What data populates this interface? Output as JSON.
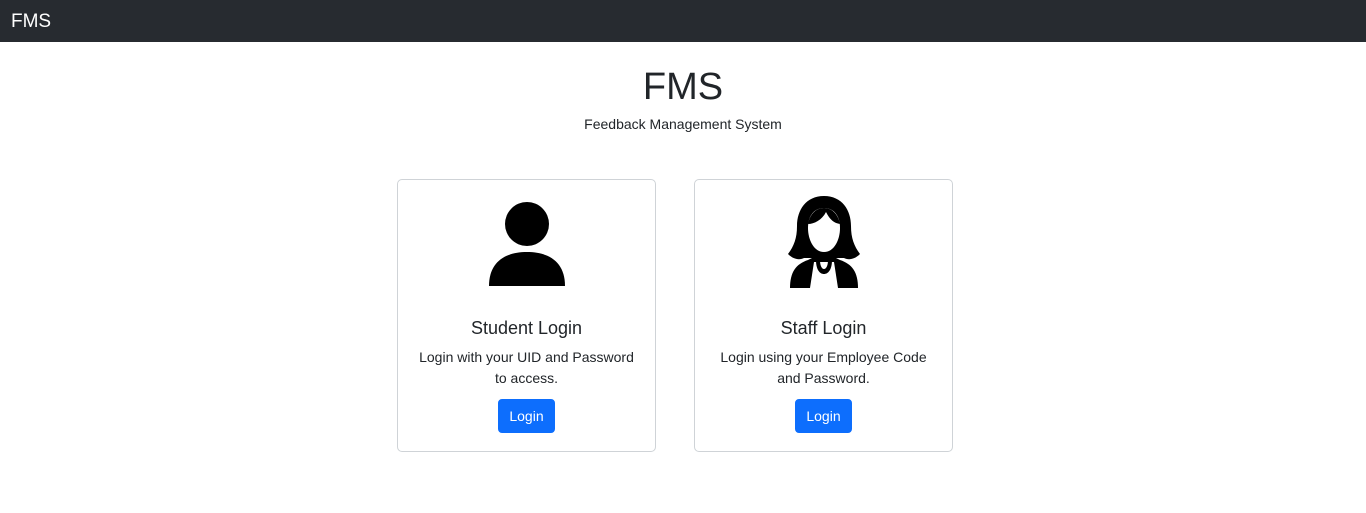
{
  "navbar": {
    "brand": "FMS"
  },
  "hero": {
    "title": "FMS",
    "subtitle": "Feedback Management System"
  },
  "cards": [
    {
      "icon": "person-icon",
      "title": "Student Login",
      "text": "Login with your UID and Password to access.",
      "button_label": "Login"
    },
    {
      "icon": "woman-icon",
      "title": "Staff Login",
      "text": "Login using your Employee Code and Password.",
      "button_label": "Login"
    }
  ],
  "colors": {
    "navbar_bg": "#272b30",
    "primary": "#0d6efd",
    "text": "#212529",
    "card_border": "#cfd3d7"
  }
}
